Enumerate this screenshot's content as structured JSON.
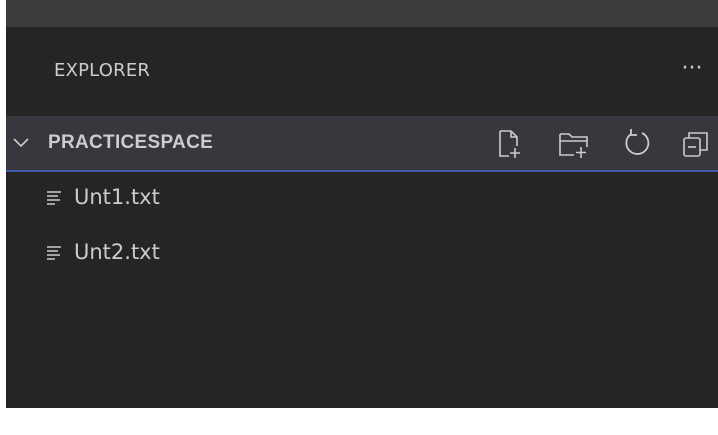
{
  "sidebar": {
    "title": "EXPLORER",
    "more_actions_label": "···",
    "icons": {
      "more": "ellipsis-icon",
      "chevron": "chevron-down-icon",
      "new_file": "new-file-icon",
      "new_folder": "new-folder-icon",
      "refresh": "refresh-icon",
      "collapse": "collapse-all-icon",
      "file": "text-file-icon"
    },
    "folder": {
      "name": "PRACTICESPACE",
      "expanded": true
    },
    "files": [
      {
        "name": "Unt1.txt"
      },
      {
        "name": "Unt2.txt"
      }
    ]
  },
  "colors": {
    "panel_bg": "#252526",
    "titlebar_bg": "#3c3c3c",
    "folder_row_bg": "#37373d",
    "focus_border": "#3e5aa7",
    "text": "#cccccc"
  }
}
